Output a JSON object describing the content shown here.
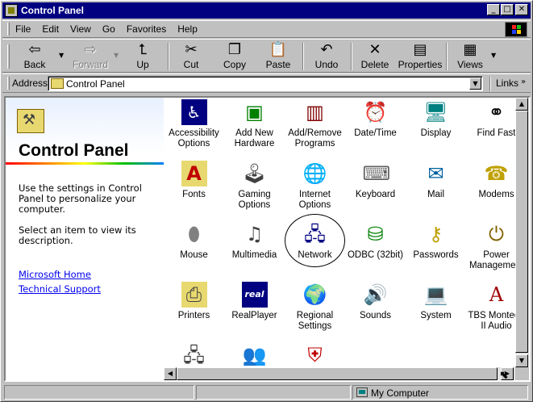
{
  "window": {
    "title": "Control Panel"
  },
  "menu": [
    "File",
    "Edit",
    "View",
    "Go",
    "Favorites",
    "Help"
  ],
  "toolbar": {
    "back": "Back",
    "forward": "Forward",
    "up": "Up",
    "cut": "Cut",
    "copy": "Copy",
    "paste": "Paste",
    "undo": "Undo",
    "delete": "Delete",
    "properties": "Properties",
    "views": "Views"
  },
  "address": {
    "label": "Address",
    "value": "Control Panel",
    "links": "Links"
  },
  "left_pane": {
    "title": "Control Panel",
    "description": "Use the settings in Control Panel to personalize your computer.",
    "hint": "Select an item to view its description.",
    "links": [
      "Microsoft Home",
      "Technical Support"
    ]
  },
  "items": [
    {
      "label": "Accessibility Options",
      "icon": "accessibility-icon"
    },
    {
      "label": "Add New Hardware",
      "icon": "hardware-icon"
    },
    {
      "label": "Add/Remove Programs",
      "icon": "programs-icon"
    },
    {
      "label": "Date/Time",
      "icon": "clock-icon"
    },
    {
      "label": "Display",
      "icon": "display-icon"
    },
    {
      "label": "Find Fast",
      "icon": "binoculars-icon"
    },
    {
      "label": "Fonts",
      "icon": "fonts-icon"
    },
    {
      "label": "Gaming Options",
      "icon": "joystick-icon"
    },
    {
      "label": "Internet Options",
      "icon": "globe-icon"
    },
    {
      "label": "Keyboard",
      "icon": "keyboard-icon"
    },
    {
      "label": "Mail",
      "icon": "mail-icon"
    },
    {
      "label": "Modems",
      "icon": "modem-icon"
    },
    {
      "label": "Mouse",
      "icon": "mouse-icon"
    },
    {
      "label": "Multimedia",
      "icon": "multimedia-icon"
    },
    {
      "label": "Network",
      "icon": "network-icon"
    },
    {
      "label": "ODBC (32bit)",
      "icon": "odbc-icon"
    },
    {
      "label": "Passwords",
      "icon": "keys-icon"
    },
    {
      "label": "Power Management",
      "icon": "power-icon"
    },
    {
      "label": "Printers",
      "icon": "printer-icon"
    },
    {
      "label": "RealPlayer",
      "icon": "realplayer-icon"
    },
    {
      "label": "Regional Settings",
      "icon": "regional-globe-icon"
    },
    {
      "label": "Sounds",
      "icon": "speaker-icon"
    },
    {
      "label": "System",
      "icon": "computer-icon"
    },
    {
      "label": "TBS Montego II Audio",
      "icon": "audio-icon"
    },
    {
      "label": "",
      "icon": "network-computers-icon"
    },
    {
      "label": "",
      "icon": "users-icon"
    },
    {
      "label": "",
      "icon": "shield-icon"
    }
  ],
  "status": {
    "text": "My Computer"
  }
}
